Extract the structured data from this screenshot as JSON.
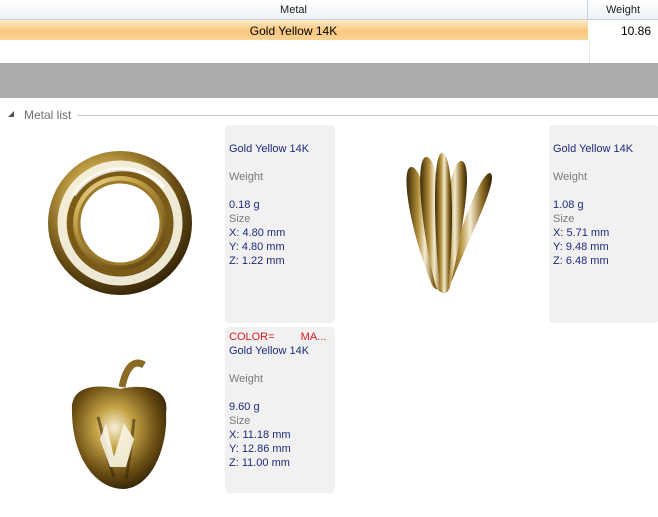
{
  "grid": {
    "columns": {
      "metal": "Metal",
      "weight": "Weight"
    },
    "rows": [
      {
        "metal": "Gold Yellow 14K",
        "weight": "10.86"
      }
    ]
  },
  "group": {
    "label": "Metal list"
  },
  "items": [
    {
      "color_label": "",
      "metal": "Gold Yellow 14K",
      "weight_label": "Weight",
      "weight": "0.18 g",
      "size_label": "Size",
      "x": "X: 4.80 mm",
      "y": "Y: 4.80 mm",
      "z": "Z: 1.22 mm"
    },
    {
      "color_label": "",
      "metal": "Gold Yellow 14K",
      "weight_label": "Weight",
      "weight": "1.08 g",
      "size_label": "Size",
      "x": "X: 5.71 mm",
      "y": "Y: 9.48 mm",
      "z": "Z: 6.48 mm"
    },
    {
      "color_label": "COLOR=",
      "color_value": "MA...",
      "metal": "Gold Yellow 14K",
      "weight_label": "Weight",
      "weight": "9.60 g",
      "size_label": "Size",
      "x": "X: 11.18 mm",
      "y": "Y: 12.86 mm",
      "z": "Z: 11.00 mm"
    }
  ],
  "colors": {
    "selection": "#f9c77d",
    "splitter": "#ababab",
    "gold": "#b38a2a",
    "info_text": "#1f2a7a",
    "color_tag": "#e01b1b"
  },
  "icons": [
    "collapse-triangle-icon"
  ]
}
